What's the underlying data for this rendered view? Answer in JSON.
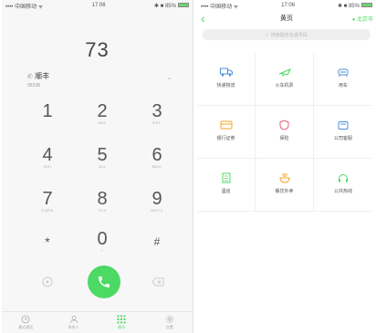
{
  "left_phone": {
    "status": {
      "carrier": "•••• 中国移动 ᯤ",
      "time": "17:06",
      "battery": "✱ ■ 85%"
    },
    "dialed_number": "73",
    "contact": {
      "name": "顺丰",
      "subtitle": "95338",
      "arrow": "⌄"
    },
    "keypad": [
      {
        "digit": "1",
        "letters": ""
      },
      {
        "digit": "2",
        "letters": "ABC"
      },
      {
        "digit": "3",
        "letters": "DEF"
      },
      {
        "digit": "4",
        "letters": "GHI"
      },
      {
        "digit": "5",
        "letters": "JKL"
      },
      {
        "digit": "6",
        "letters": "MNO"
      },
      {
        "digit": "7",
        "letters": "PQRS"
      },
      {
        "digit": "8",
        "letters": "TUV"
      },
      {
        "digit": "9",
        "letters": "WXYZ"
      },
      {
        "digit": "*",
        "letters": ""
      },
      {
        "digit": "0",
        "letters": "+"
      },
      {
        "digit": "#",
        "letters": ""
      }
    ],
    "tabs": [
      {
        "label": "最近通话",
        "icon": "clock-icon"
      },
      {
        "label": "联系人",
        "icon": "contacts-icon"
      },
      {
        "label": "拨号",
        "icon": "keypad-icon",
        "active": true
      },
      {
        "label": "设置",
        "icon": "gear-icon"
      }
    ],
    "accent_color": "#4cd964"
  },
  "right_phone": {
    "status": {
      "carrier": "•••• 中国移动 ᯤ",
      "time": "17:06",
      "battery": "✱ ■ 85%"
    },
    "title": "黄页",
    "city": "● 北京市",
    "search_placeholder": "搜索服务名或号码",
    "categories": [
      {
        "label": "快递物流",
        "icon": "delivery-truck-icon",
        "color": "#4a90d9"
      },
      {
        "label": "火车机票",
        "icon": "plane-icon",
        "color": "#4cd964"
      },
      {
        "label": "用车",
        "icon": "car-icon",
        "color": "#4a90d9"
      },
      {
        "label": "银行证券",
        "icon": "bank-card-icon",
        "color": "#f5a623"
      },
      {
        "label": "保险",
        "icon": "shield-icon",
        "color": "#e85d75"
      },
      {
        "label": "公司客服",
        "icon": "service-icon",
        "color": "#4a90d9"
      },
      {
        "label": "酒店",
        "icon": "hotel-icon",
        "color": "#4cd964"
      },
      {
        "label": "餐饮外卖",
        "icon": "food-icon",
        "color": "#f5a623"
      },
      {
        "label": "公共热线",
        "icon": "headset-icon",
        "color": "#4cd964"
      }
    ],
    "accent_color": "#4cd964"
  }
}
